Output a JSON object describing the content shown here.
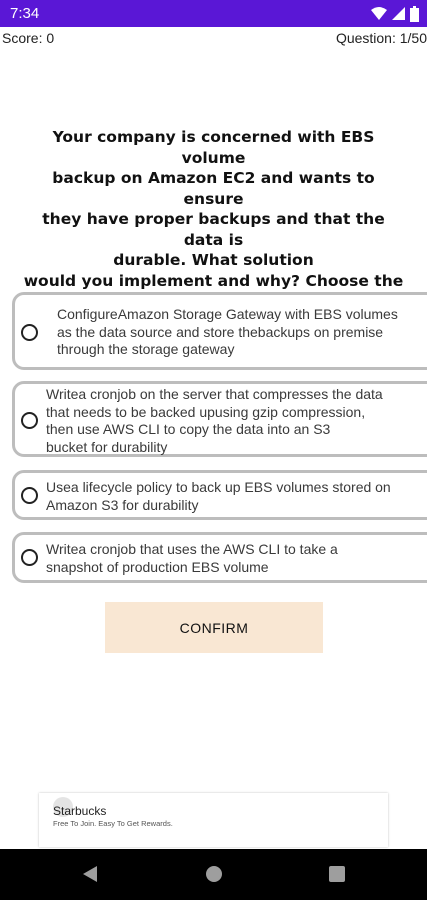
{
  "status_bar": {
    "time": "7:34"
  },
  "header": {
    "score": "Score: 0",
    "question_counter": "Question: 1/50"
  },
  "question": {
    "text": "Your company is concerned with EBS volume\nbackup on Amazon EC2 and wants to ensure\nthey have proper backups and that the data is\ndurable. What solution\nwould you implement and why? Choose the\ncorrect answer from the options below"
  },
  "options": [
    {
      "text": "ConfigureAmazon Storage Gateway with EBS volumes\nas the data source and store thebackups on premise\nthrough the storage gateway",
      "selected": false
    },
    {
      "text": "Writea cronjob on the server that compresses the data\nthat needs to be backed upusing gzip compression,\nthen use AWS CLI to copy the data into an S3\nbucket for durability",
      "selected": false
    },
    {
      "text": "Usea lifecycle policy to back up EBS volumes stored on\nAmazon S3 for durability",
      "selected": false
    },
    {
      "text": "Writea cronjob that uses the AWS CLI to take a\nsnapshot of production EBS volume",
      "selected": false
    }
  ],
  "confirm_button": {
    "label": "CONFIRM"
  },
  "ad": {
    "brand": "Starbucks",
    "tagline": "Free To Join. Easy To Get Rewards."
  },
  "colors": {
    "status_bar": "#5a17d6",
    "confirm_bg": "#f9e7d3",
    "option_border": "#bdbdbd",
    "nav_bar": "#000000"
  },
  "icons": [
    "wifi-icon",
    "signal-icon",
    "battery-icon",
    "back-icon",
    "home-icon",
    "recents-icon"
  ]
}
